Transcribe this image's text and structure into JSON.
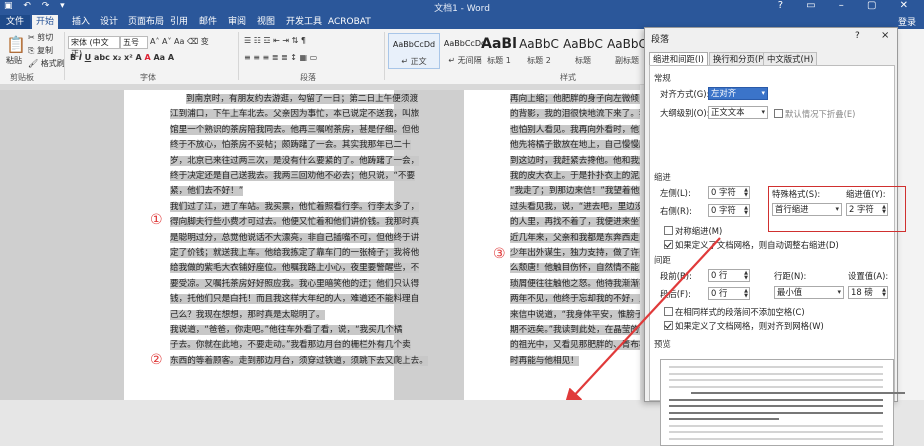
{
  "window": {
    "title": "文档1 - Word",
    "login": "登录"
  },
  "tabs": [
    "文件",
    "开始",
    "插入",
    "设计",
    "页面布局",
    "引用",
    "邮件",
    "审阅",
    "视图",
    "开发工具",
    "ACROBAT"
  ],
  "ribbon": {
    "clipboard": {
      "paste": "粘贴",
      "cut": "剪切",
      "copy": "复制",
      "format_painter": "格式刷",
      "label": "剪贴板"
    },
    "font": {
      "name": "宋体 (中文正)",
      "size": "五号",
      "label": "字体"
    },
    "paragraph": {
      "label": "段落"
    },
    "styles": {
      "label": "样式",
      "items": [
        {
          "preview": "AaBbCcDd",
          "name": "↵ 正文"
        },
        {
          "preview": "AaBbCcDd",
          "name": "↵ 无间隔"
        },
        {
          "preview": "AaBl",
          "name": "标题 1"
        },
        {
          "preview": "AaBbC",
          "name": "标题 2"
        },
        {
          "preview": "AaBbC",
          "name": "标题"
        },
        {
          "preview": "AaBbC",
          "name": "副标题"
        }
      ]
    }
  },
  "document": {
    "left_page_lines": [
      "到南京时，有朋友约去游逛，勾留了一日；第二日上午便须渡",
      "江到浦口，下午上车北去。父亲因为事忙，本已说定不送我，叫旅",
      "馆里一个熟识的茶房陪我同去。他再三嘱咐茶房，甚是仔细。但他",
      "终于不放心，怕茶房不妥帖；颇踌躇了一会。其实我那年已二十",
      "岁，北京已来往过两三次，是没有什么要紧的了。他踌躇了一会，",
      "终于决定还是自己送我去。我两三回劝他不必去；他只说，“不要",
      "紧，他们去不好！”",
      "我们过了江，进了车站。我买票，他忙着照看行李。行李太多了，",
      "得向脚夫行些小费才可过去。他便又忙着和他们讲价钱。我那时真",
      "是聪明过分，总觉他说话不大漂亮，非自己插嘴不可，但他终于讲",
      "定了价钱；就送我上车。他给我拣定了靠车门的一张椅子；我将他",
      "给我做的紫毛大衣铺好座位。他嘱我路上小心，夜里要警醒些，不",
      "要受凉。又嘱托茶房好好照应我。我心里暗笑他的迂；他们只认得",
      "钱，托他们只是白托！而且我这样大年纪的人，难道还不能料理自",
      "己么？我现在想想，那时真是太聪明了。",
      "我说道，“爸爸，你走吧。”他往车外看了看，说，“我买几个橘",
      "子去。你就在此地，不要走动。”我看那边月台的栅栏外有几个卖",
      "东西的等着顾客。走到那边月台，须穿过铁道，须跳下去又爬上去。"
    ],
    "right_page_lines": [
      "再向上缩；他肥胖的身子向左微倾，显",
      "的背影，我的泪很快地流下来了。我赶",
      "也怕别人看见。我再向外看时，他已抱",
      "他先将橘子散放在地上，自己慢慢爬下",
      "到这边时，我赶紧去搀他。他和我走到",
      "我的皮大衣上。于是扑扑衣上的泥土，",
      "“我走了；到那边来信！”我望着他走",
      "过头看见我，说，“进去吧，里边没人",
      "的人里，再找不着了，我便进来坐下，",
      "近几年来，父亲和我都是东奔西走，家",
      "少年出外谋生，独力支持，做了许多大",
      "么颓唐！他触目伤怀，自然情不能自已，",
      "琐屑便往往触他之怒。他待我渐渐不同",
      "两年不见，他终于忘却我的不好，只是",
      "来信中说道，“我身体平安，惟膀子疼",
      "期不远矣。”我读到此处，在晶莹的泪",
      "的祖光中，又看见那肥胖的、青布棉袍",
      "时再能与他相见！"
    ],
    "markers": [
      "①",
      "②",
      "③"
    ]
  },
  "dialog": {
    "title": "段落",
    "help": "?",
    "close": "×",
    "tabs": [
      "缩进和间距(I)",
      "换行和分页(P)",
      "中文版式(H)"
    ],
    "general": {
      "section": "常规",
      "alignment_label": "对齐方式(G):",
      "alignment_value": "左对齐",
      "outline_label": "大纲级别(O):",
      "outline_value": "正文文本",
      "collapse_label": "默认情况下折叠(E)"
    },
    "indent": {
      "section": "缩进",
      "left_label": "左侧(L):",
      "left_value": "0 字符",
      "right_label": "右侧(R):",
      "right_value": "0 字符",
      "special_label": "特殊格式(S):",
      "special_value": "首行缩进",
      "by_label": "缩进值(Y):",
      "by_value": "2 字符",
      "mirror_label": "对称缩进(M)",
      "auto_right_label": "如果定义了文档网格，则自动调整右缩进(D)"
    },
    "spacing": {
      "section": "间距",
      "before_label": "段前(B):",
      "before_value": "0 行",
      "after_label": "段后(F):",
      "after_value": "0 行",
      "line_label": "行距(N):",
      "line_value": "最小值",
      "at_label": "设置值(A):",
      "at_value": "18 磅",
      "no_space_label": "在相同样式的段落间不添加空格(C)",
      "snap_label": "如果定义了文档网格，则对齐到网格(W)"
    },
    "preview": {
      "section": "预览"
    }
  },
  "colors": {
    "title_blue": "#2b579a",
    "highlight": "#c8c8c8",
    "annotation_red": "#e03a3a"
  }
}
